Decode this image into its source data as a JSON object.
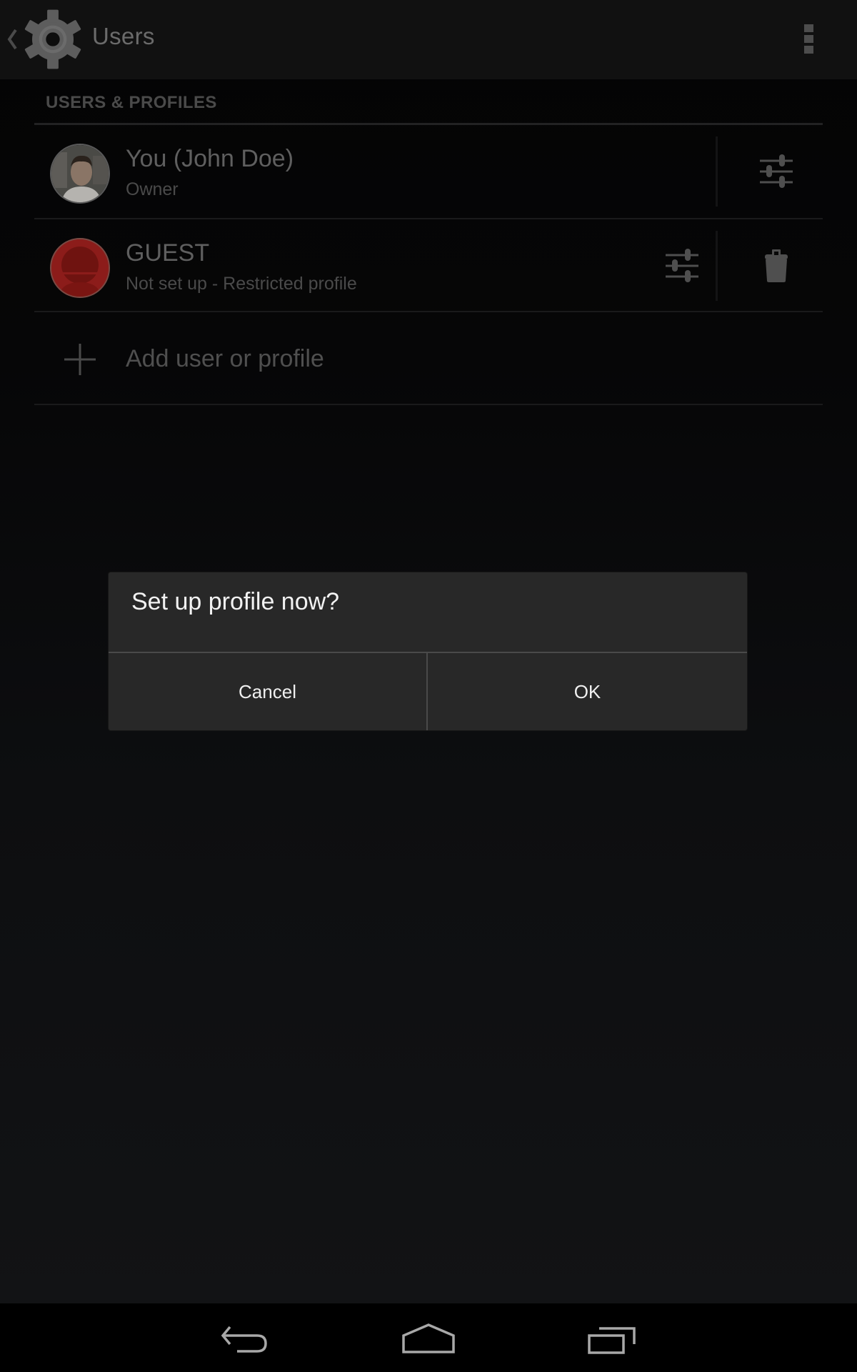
{
  "action_bar": {
    "title": "Users",
    "icons": {
      "up": "chevron-left-icon",
      "app": "settings-gear-icon",
      "overflow": "overflow-menu-icon"
    }
  },
  "section": {
    "header": "USERS & PROFILES"
  },
  "users": [
    {
      "name": "You (John Doe)",
      "subtitle": "Owner",
      "avatar": "user-photo",
      "actions": [
        "settings-sliders-icon"
      ]
    },
    {
      "name": "GUEST",
      "subtitle": "Not set up - Restricted profile",
      "avatar": "default-red-avatar",
      "avatar_color": "#8c1c1a",
      "actions": [
        "settings-sliders-icon",
        "trash-icon"
      ]
    }
  ],
  "add_row": {
    "label": "Add user or profile",
    "icon": "plus-icon"
  },
  "dialog": {
    "title": "Set up profile now?",
    "cancel_label": "Cancel",
    "ok_label": "OK"
  },
  "nav_bar": {
    "icons": [
      "back-icon",
      "home-icon",
      "recents-icon"
    ]
  }
}
